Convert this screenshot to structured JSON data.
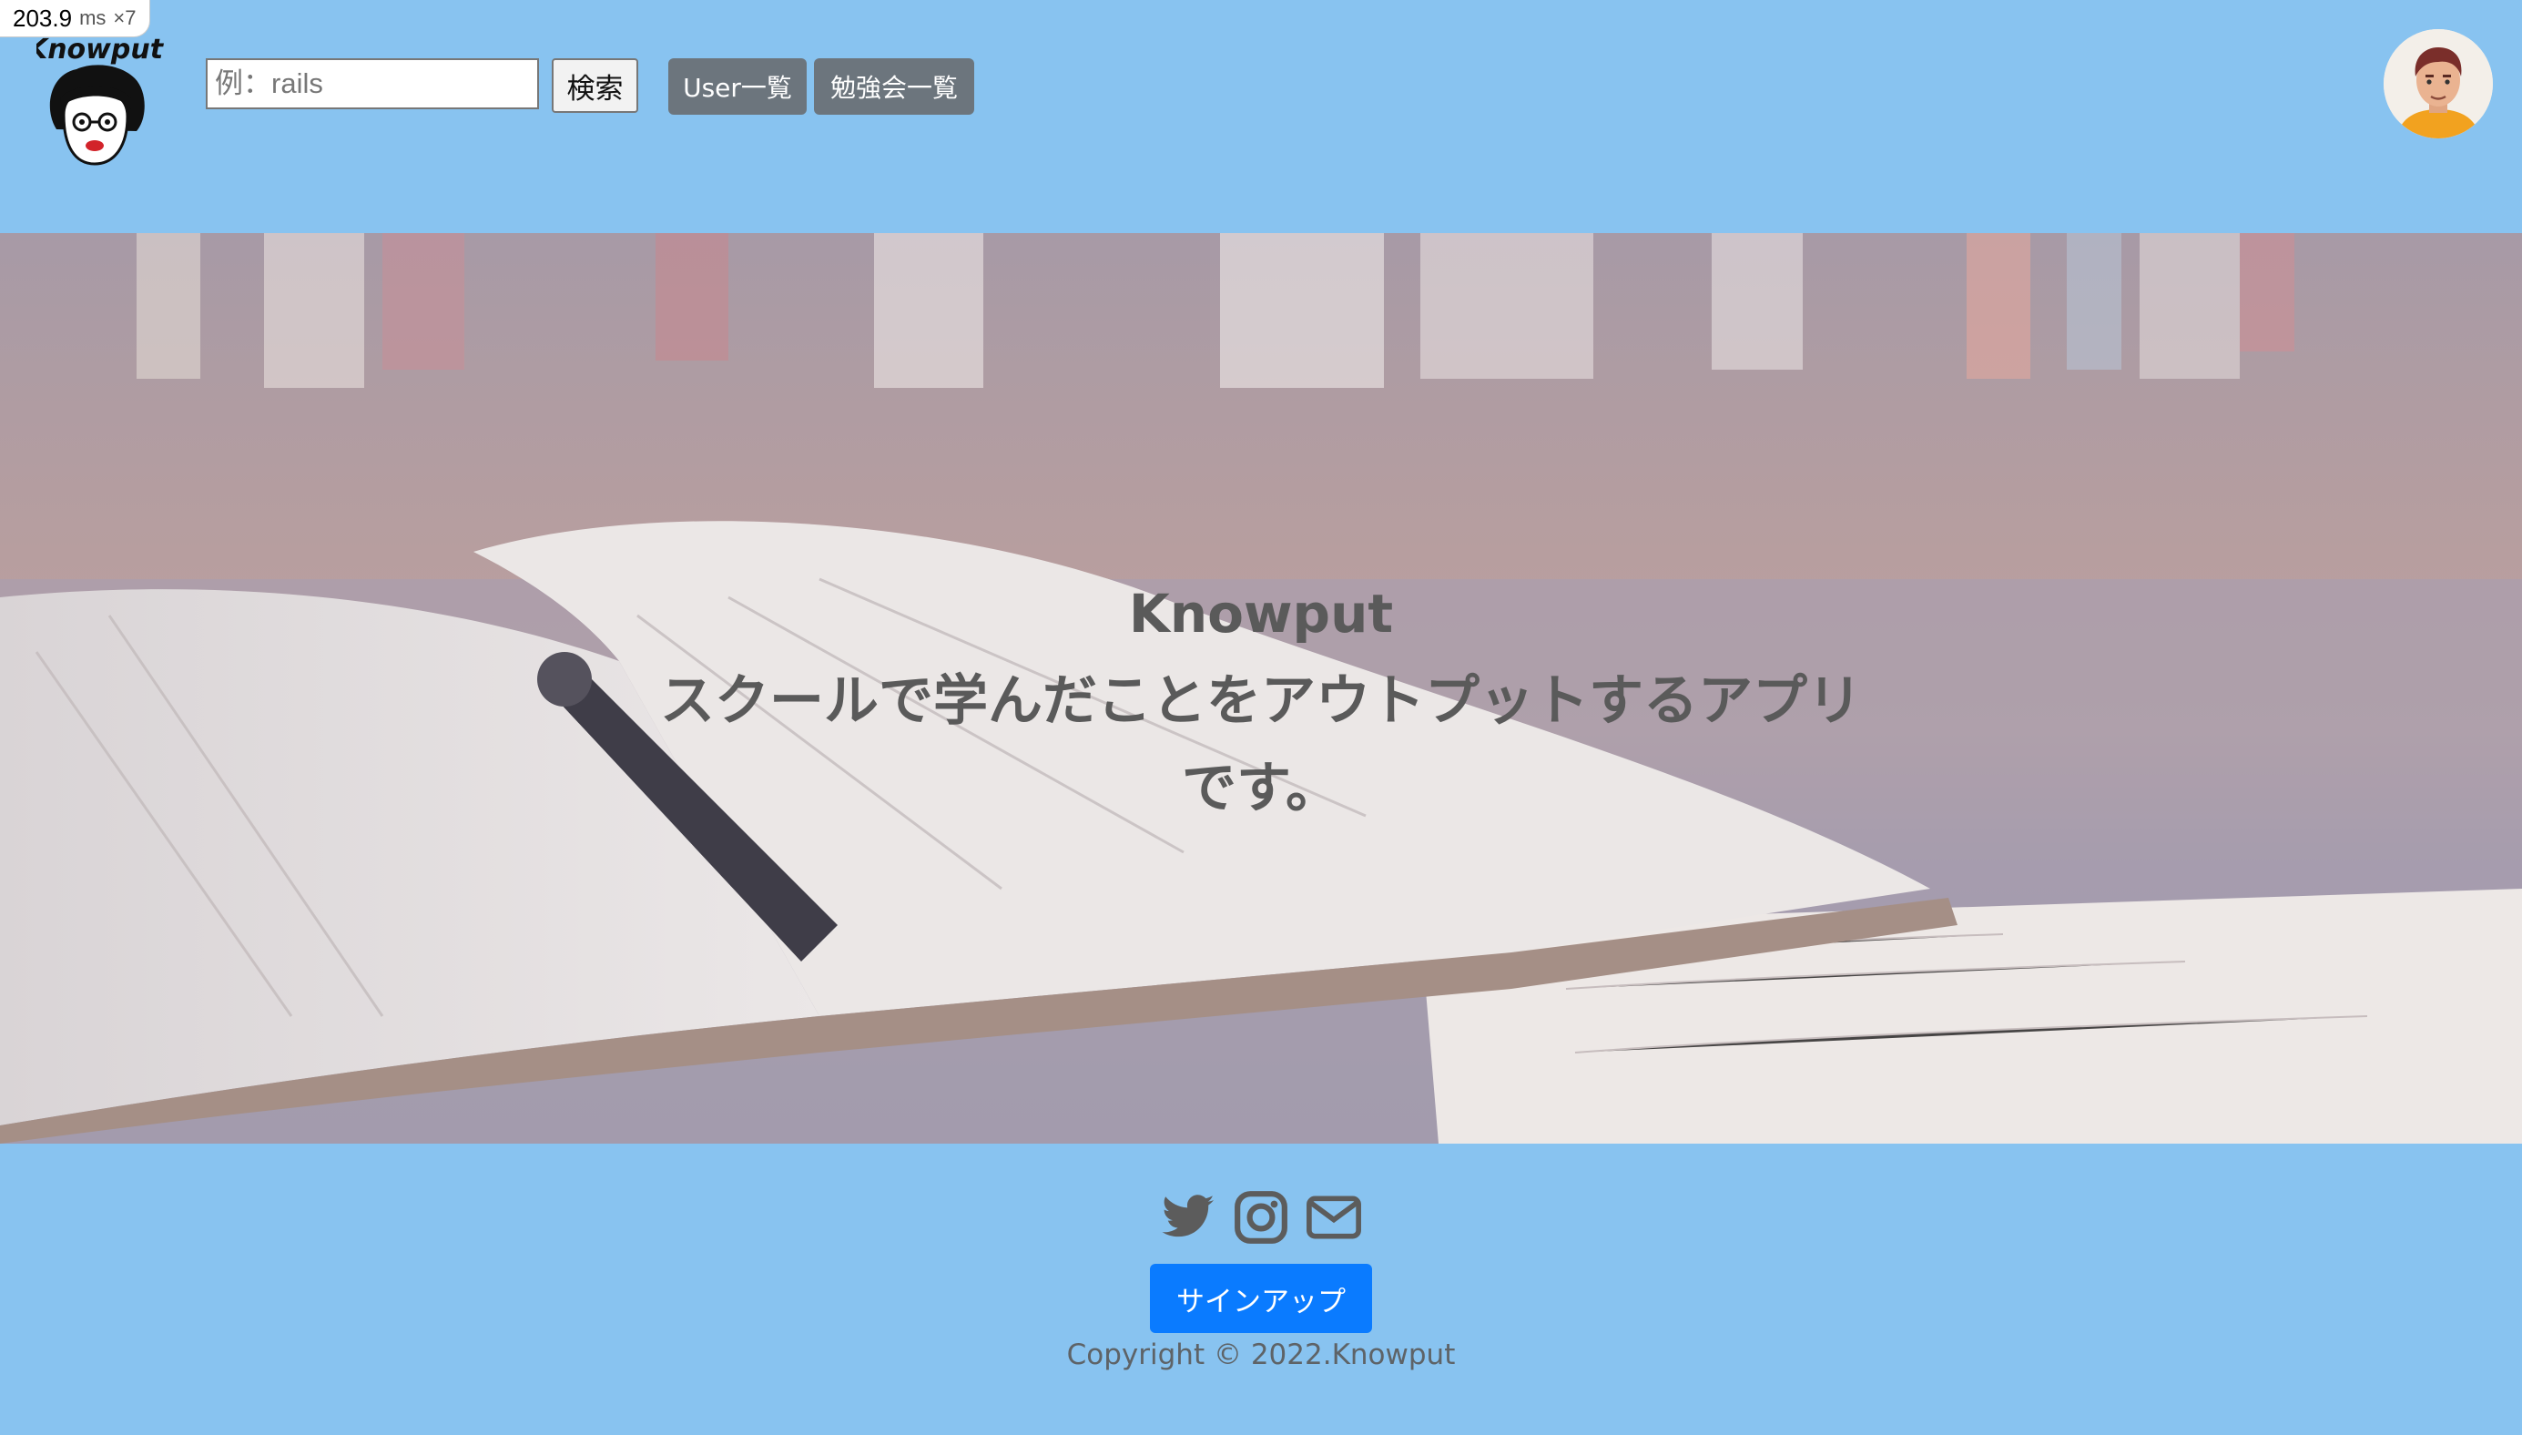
{
  "perf": {
    "value": "203.9",
    "unit": "ms",
    "multiplier": "×7"
  },
  "header": {
    "logo_text": "Knowput",
    "search": {
      "placeholder": "例：rails",
      "value": "",
      "button_label": "検索"
    },
    "nav": [
      {
        "label": "User一覧"
      },
      {
        "label": "勉強会一覧"
      }
    ],
    "avatar_icon": "user-avatar"
  },
  "hero": {
    "title": "Knowput",
    "subtitle": "スクールで学んだことをアウトプットするアプリです。"
  },
  "footer": {
    "social_icons": [
      "twitter-icon",
      "instagram-icon",
      "mail-icon"
    ],
    "signup_label": "サインアップ",
    "copyright": "Copyright © 2022.Knowput"
  },
  "colors": {
    "header_bg": "#88c3f0",
    "nav_button": "#6c757d",
    "primary": "#0a7bff",
    "hero_text": "#5a5a5a",
    "social_icon": "#5c5c5c"
  }
}
